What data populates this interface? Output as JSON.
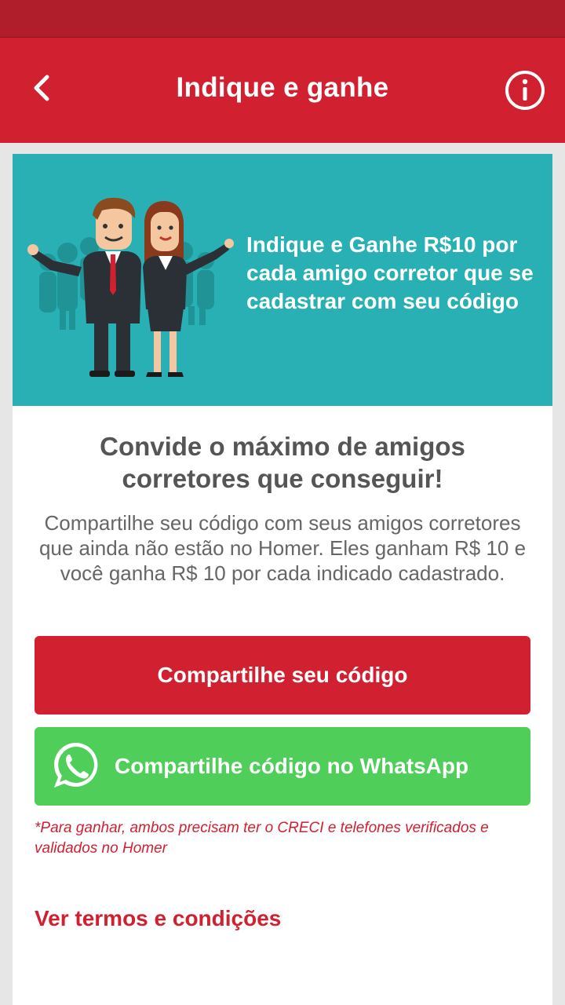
{
  "header": {
    "title": "Indique e ganhe",
    "back_icon": "chevron-left-icon",
    "info_icon": "info-icon"
  },
  "banner": {
    "text": "Indique e Ganhe R$10 por cada amigo corretor que se cadastrar com seu código",
    "background_color": "#29b0b4"
  },
  "content": {
    "headline": "Convide o máximo de amigos corretores que conseguir!",
    "description": "Compartilhe seu código com seus amigos corretores que ainda não estão no Homer. Eles ganham R$ 10 e você ganha R$ 10 por cada indicado cadastrado."
  },
  "buttons": {
    "share_label": "Compartilhe seu código",
    "whatsapp_label": "Compartilhe código no WhatsApp"
  },
  "footnote": "*Para ganhar, ambos precisam ter o CRECI e telefones verificados e validados no Homer",
  "terms_link": "Ver termos e condições",
  "colors": {
    "brand_red": "#d12030",
    "status_bar": "#b01e2c",
    "whatsapp_green": "#4fcf5a"
  }
}
